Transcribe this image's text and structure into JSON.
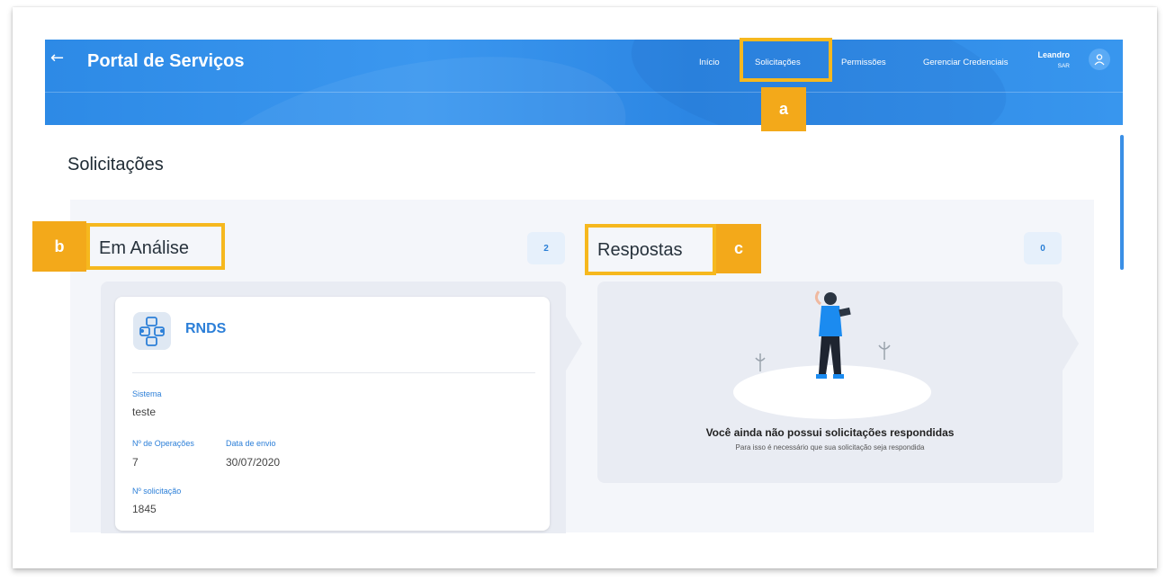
{
  "header": {
    "back_glyph": "←",
    "brand": "Portal de Serviços",
    "nav": [
      {
        "label": "Início"
      },
      {
        "label": "Solicitações"
      },
      {
        "label": "Permissões"
      },
      {
        "label": "Gerenciar Credenciais"
      }
    ],
    "user": {
      "name": "Leandro",
      "sub": "SAR"
    }
  },
  "page": {
    "title": "Solicitações"
  },
  "sections": {
    "analysis": {
      "title": "Em Análise",
      "count": "2"
    },
    "responses": {
      "title": "Respostas",
      "count": "0"
    }
  },
  "request": {
    "name": "RNDS",
    "fields": {
      "sistema_label": "Sistema",
      "sistema_value": "teste",
      "operacoes_label": "Nº de Operações",
      "operacoes_value": "7",
      "envio_label": "Data de envio",
      "envio_value": "30/07/2020",
      "solicitacao_label": "Nº solicitação",
      "solicitacao_value": "1845"
    }
  },
  "empty_state": {
    "title": "Você ainda não possui solicitações respondidas",
    "subtitle": "Para isso é necessário que sua solicitação seja respondida"
  },
  "callouts": {
    "a": "a",
    "b": "b",
    "c": "c"
  },
  "colors": {
    "header_blue": "#3b97ef",
    "accent_blue": "#2c7fd8",
    "callout_orange": "#f3a91a"
  },
  "icons": [
    "back-arrow-icon",
    "user-icon",
    "rnds-network-icon",
    "empty-state-illustration"
  ]
}
